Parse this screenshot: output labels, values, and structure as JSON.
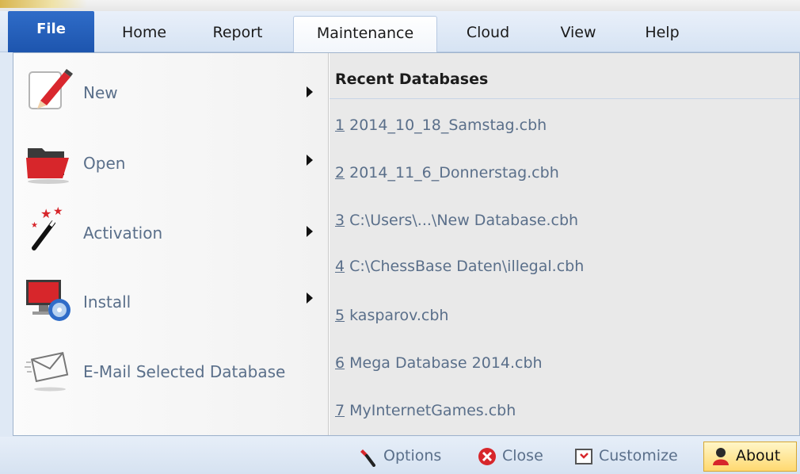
{
  "tabs": [
    {
      "label": "File"
    },
    {
      "label": "Home"
    },
    {
      "label": "Report"
    },
    {
      "label": "Maintenance"
    },
    {
      "label": "Cloud"
    },
    {
      "label": "View"
    },
    {
      "label": "Help"
    }
  ],
  "active_tab": "File",
  "menu": [
    {
      "label": "New",
      "icon": "pencil-document-icon",
      "has_submenu": true
    },
    {
      "label": "Open",
      "icon": "folder-icon",
      "has_submenu": true
    },
    {
      "label": "Activation",
      "icon": "magic-wand-icon",
      "has_submenu": true
    },
    {
      "label": "Install",
      "icon": "monitor-disc-icon",
      "has_submenu": true
    },
    {
      "label": "E-Mail Selected Database",
      "icon": "envelope-icon",
      "has_submenu": false
    }
  ],
  "recent": {
    "title": "Recent Databases",
    "items": [
      {
        "num": "1",
        "name": " 2014_10_18_Samstag.cbh"
      },
      {
        "num": "2",
        "name": " 2014_11_6_Donnerstag.cbh"
      },
      {
        "num": "3",
        "name": " C:\\Users\\...\\New Database.cbh"
      },
      {
        "num": "4",
        "name": " C:\\ChessBase Daten\\illegal.cbh"
      },
      {
        "num": "5",
        "name": " kasparov.cbh"
      },
      {
        "num": "6",
        "name": " Mega Database 2014.cbh"
      },
      {
        "num": "7",
        "name": " MyInternetGames.cbh"
      }
    ]
  },
  "bottom": {
    "options": "Options",
    "close": "Close",
    "customize": "Customize",
    "about": "About"
  },
  "colors": {
    "file_tab": "#1d55ae",
    "menu_text": "#5a6f8a",
    "about_bg": "#ffd970"
  }
}
